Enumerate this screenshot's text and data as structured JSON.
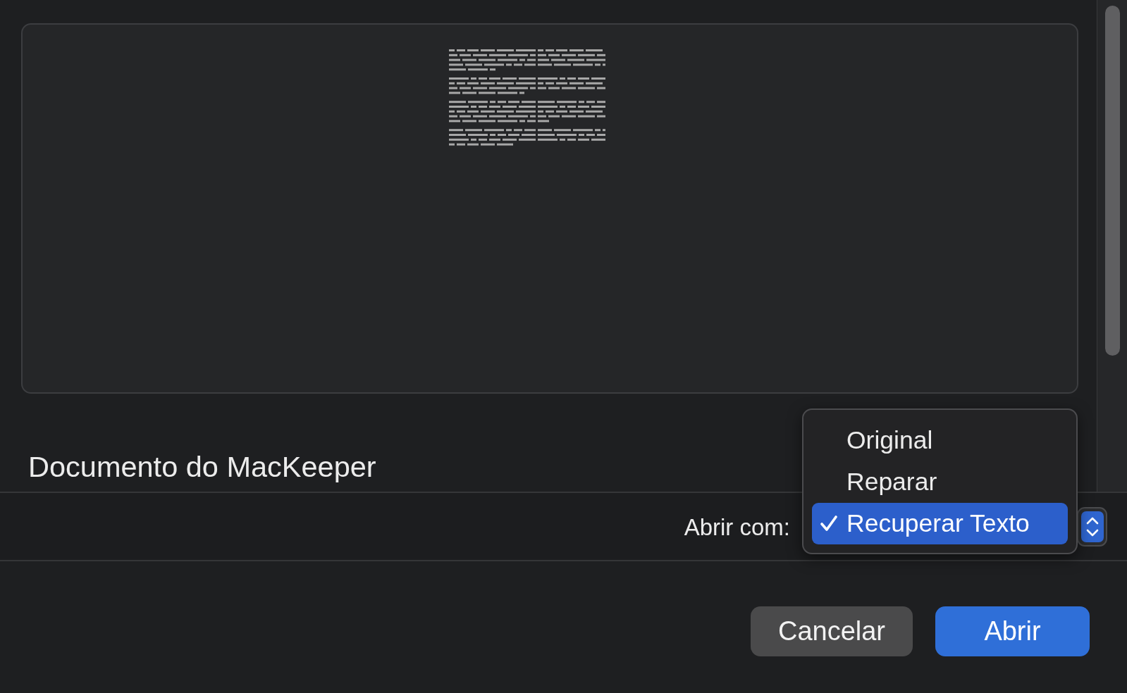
{
  "file_name": "Documento do MacKeeper",
  "open_with": {
    "label": "Abrir com:",
    "menu": {
      "items": [
        {
          "label": "Original",
          "selected": false
        },
        {
          "label": "Reparar",
          "selected": false
        },
        {
          "label": "Recuperar Texto",
          "selected": true
        }
      ]
    }
  },
  "buttons": [
    {
      "label": "Cancelar",
      "kind": "secondary"
    },
    {
      "label": "Abrir",
      "kind": "primary"
    }
  ]
}
